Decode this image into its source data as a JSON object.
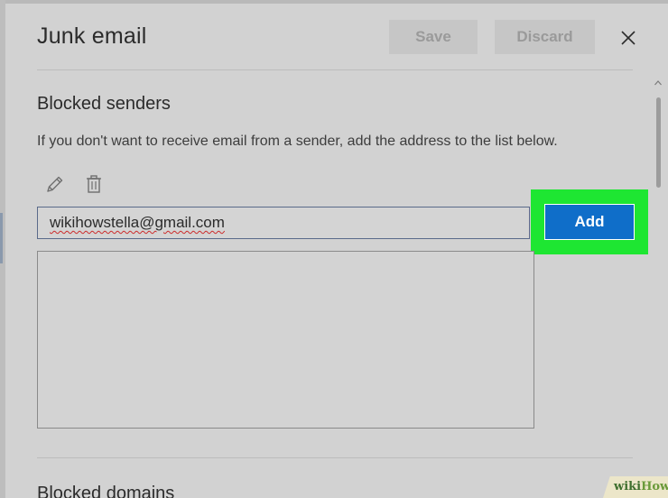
{
  "dialog": {
    "title": "Junk email",
    "save_label": "Save",
    "discard_label": "Discard",
    "close_icon": "close-icon"
  },
  "blocked_senders": {
    "heading": "Blocked senders",
    "description": "If you don't want to receive email from a sender, add the address to the list below.",
    "edit_icon": "pencil-icon",
    "delete_icon": "trash-icon",
    "input_value": "wikihowstella@gmail.com",
    "add_label": "Add",
    "entries": []
  },
  "blocked_domains": {
    "heading": "Blocked domains"
  },
  "colors": {
    "accent": "#0f6ec9",
    "highlight": "#1ee632",
    "background": "#d2d2d2"
  },
  "watermark": {
    "part1": "wiki",
    "part2": "How"
  }
}
